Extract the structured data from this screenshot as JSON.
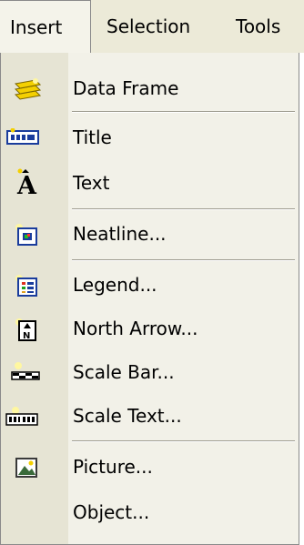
{
  "menubar": {
    "insert_label": "Insert",
    "selection_label": "Selection",
    "tools_label": "Tools"
  },
  "menu": {
    "items": [
      {
        "label": "Data Frame",
        "icon": "data-frame-icon"
      },
      {
        "label": "Title",
        "icon": "title-icon"
      },
      {
        "label": "Text",
        "icon": "text-icon"
      },
      {
        "label": "Neatline...",
        "icon": "neatline-icon"
      },
      {
        "label": "Legend...",
        "icon": "legend-icon"
      },
      {
        "label": "North Arrow...",
        "icon": "north-arrow-icon"
      },
      {
        "label": "Scale Bar...",
        "icon": "scale-bar-icon"
      },
      {
        "label": "Scale Text...",
        "icon": "scale-text-icon"
      },
      {
        "label": "Picture...",
        "icon": "picture-icon"
      },
      {
        "label": "Object...",
        "icon": ""
      }
    ]
  },
  "colors": {
    "menu_bg": "#f2f1e8",
    "icon_strip_bg": "#e6e4d4",
    "menubar_bg": "#ecead8",
    "icon_yellow": "#f4d000",
    "icon_blue": "#1a3c9c"
  }
}
